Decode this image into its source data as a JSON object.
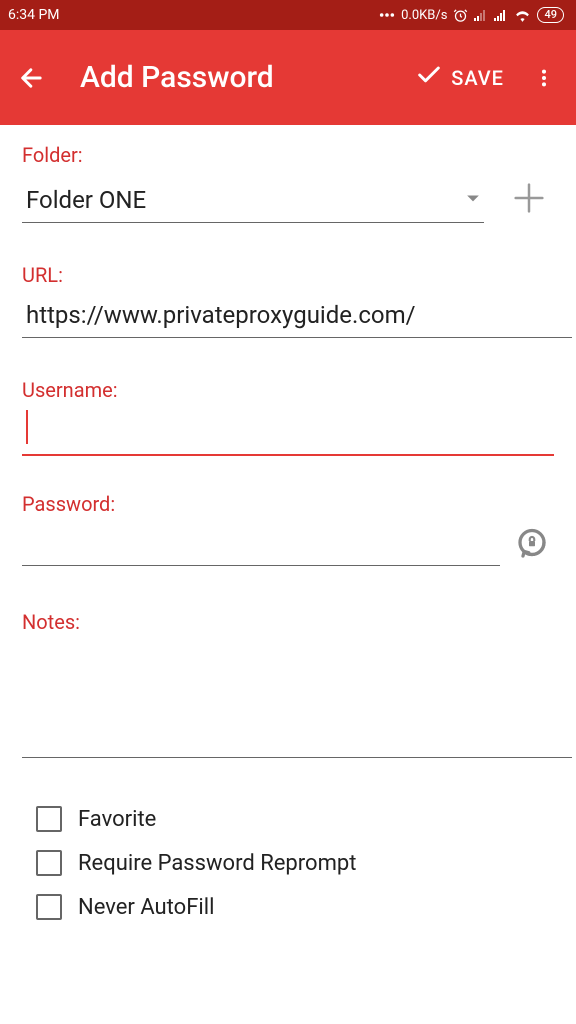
{
  "status": {
    "time": "6:34 PM",
    "network_speed": "0.0KB/s",
    "battery": "49"
  },
  "header": {
    "title": "Add Password",
    "save_label": "SAVE"
  },
  "fields": {
    "folder_label": "Folder:",
    "folder_value": "Folder ONE",
    "url_label": "URL:",
    "url_value": "https://www.privateproxyguide.com/",
    "username_label": "Username:",
    "username_value": "",
    "password_label": "Password:",
    "password_value": "",
    "notes_label": "Notes:",
    "notes_value": ""
  },
  "checkboxes": [
    {
      "label": "Favorite"
    },
    {
      "label": "Require Password Reprompt"
    },
    {
      "label": "Never AutoFill"
    }
  ]
}
